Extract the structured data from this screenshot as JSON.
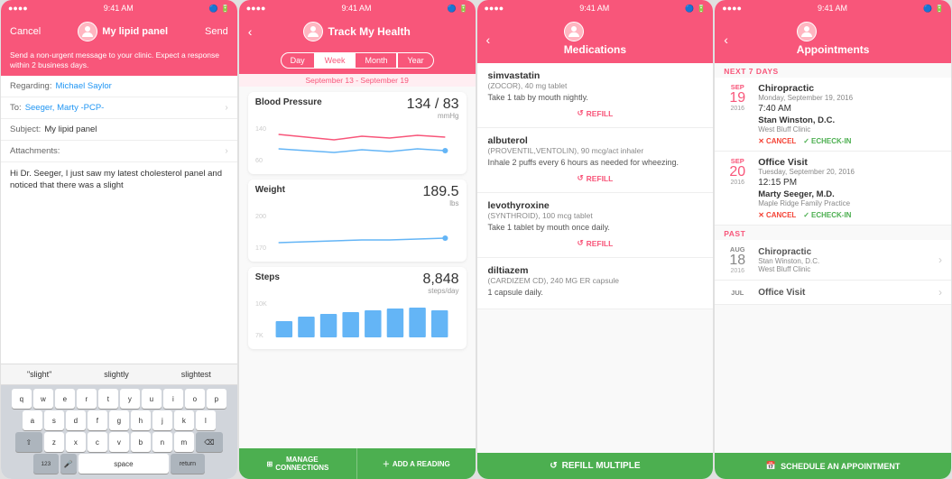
{
  "panel1": {
    "status": "9:41 AM",
    "cancel_label": "Cancel",
    "title": "My lipid panel",
    "send_label": "Send",
    "notice": "Send a non-urgent message to your clinic. Expect a response within 2 business days.",
    "regarding_label": "Regarding:",
    "regarding_value": "Michael Saylor",
    "to_label": "To:",
    "to_value": "Seeger, Marty -PCP-",
    "subject_label": "Subject:",
    "subject_value": "My lipid panel",
    "attachments_label": "Attachments:",
    "message_body": "Hi Dr. Seeger, I just saw my latest cholesterol panel and noticed that there was a slight",
    "autocomplete": [
      "\"slight\"",
      "slightly",
      "slightest"
    ],
    "keyboard_rows": [
      [
        "q",
        "w",
        "e",
        "r",
        "t",
        "y",
        "u",
        "i",
        "o",
        "p"
      ],
      [
        "a",
        "s",
        "d",
        "f",
        "g",
        "h",
        "j",
        "k",
        "l"
      ],
      [
        "z",
        "x",
        "c",
        "v",
        "b",
        "n",
        "m"
      ]
    ],
    "bottom_keys": [
      "123",
      "space",
      "return"
    ]
  },
  "panel2": {
    "status": "9:41 AM",
    "back_label": "‹",
    "title": "Track My Health",
    "tabs": [
      "Day",
      "Week",
      "Month",
      "Year"
    ],
    "active_tab": "Week",
    "date_range": "September 13 - September 19",
    "metrics": [
      {
        "name": "Blood Pressure",
        "value": "134 / 83",
        "unit": "mmHg",
        "chart_type": "line",
        "y_max": 140,
        "y_min": 60
      },
      {
        "name": "Weight",
        "value": "189.5",
        "unit": "lbs",
        "chart_type": "line",
        "y_max": 200,
        "y_min": 170
      },
      {
        "name": "Steps",
        "value": "8,848",
        "unit": "steps/day",
        "chart_type": "bar",
        "y_max": "10K",
        "y_min": "7K",
        "bars": [
          40,
          55,
          65,
          70,
          80,
          85,
          90,
          75
        ]
      }
    ],
    "footer_buttons": [
      "MANAGE\nCONNECTIONS",
      "ADD A READING"
    ]
  },
  "panel3": {
    "status": "9:41 AM",
    "back_label": "‹",
    "title": "Medications",
    "medications": [
      {
        "name": "simvastatin",
        "sub": "(ZOCOR), 40 mg tablet",
        "instructions": "Take 1 tab by mouth nightly.",
        "refill": "REFILL"
      },
      {
        "name": "albuterol",
        "sub": "(PROVENTIL,VENTOLIN), 90 mcg/act inhaler",
        "instructions": "Inhale 2 puffs every 6 hours as needed for wheezing.",
        "refill": "REFILL"
      },
      {
        "name": "levothyroxine",
        "sub": "(SYNTHROID), 100 mcg tablet",
        "instructions": "Take 1 tablet by mouth once daily.",
        "refill": "REFILL"
      },
      {
        "name": "diltiazem",
        "sub": "(CARDIZEM CD), 240 MG ER capsule",
        "instructions": "1 capsule daily.",
        "refill": "REFILL"
      }
    ],
    "footer_label": "⟳ REFILL MULTIPLE"
  },
  "panel4": {
    "status": "9:41 AM",
    "back_label": "‹",
    "title": "Appointments",
    "next_section_label": "NEXT 7 DAYS",
    "appointments": [
      {
        "month": "SEP",
        "day": "19",
        "year": "2016",
        "type": "Chiropractic",
        "date_text": "Monday, September 19, 2016",
        "time": "7:40 AM",
        "doctor": "Stan Winston, D.C.",
        "clinic": "West Bluff Clinic",
        "cancel_label": "CANCEL",
        "checkin_label": "ECHECK-IN"
      },
      {
        "month": "SEP",
        "day": "20",
        "year": "2016",
        "type": "Office Visit",
        "date_text": "Tuesday, September 20, 2016",
        "time": "12:15 PM",
        "doctor": "Marty Seeger, M.D.",
        "clinic": "Maple Ridge Family Practice",
        "cancel_label": "CANCEL",
        "checkin_label": "ECHECK-IN"
      }
    ],
    "past_section_label": "PAST",
    "past_appointments": [
      {
        "month": "AUG",
        "day": "18",
        "year": "2016",
        "type": "Chiropractic",
        "sub": "Stan Winston, D.C.\nWest Bluff Clinic"
      },
      {
        "month": "JUL",
        "day": "",
        "year": "",
        "type": "Office Visit",
        "sub": ""
      }
    ],
    "footer_label": "📅 SCHEDULE AN APPOINTMENT"
  }
}
